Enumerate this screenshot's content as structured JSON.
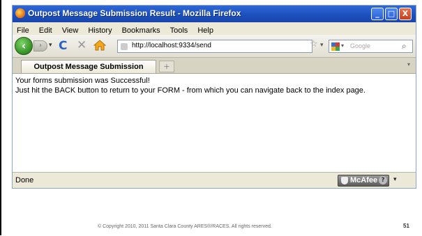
{
  "window": {
    "title": "Outpost Message Submission Result - Mozilla Firefox",
    "controls": {
      "minimize": "_",
      "maximize": "□",
      "close": "X"
    }
  },
  "menu": [
    "File",
    "Edit",
    "View",
    "History",
    "Bookmarks",
    "Tools",
    "Help"
  ],
  "toolbar": {
    "back": "‹",
    "forward": "›",
    "dropdown": "▾",
    "reload": "C",
    "stop": "✕",
    "url": "http://localhost:9334/send",
    "bookmark_star": "☆",
    "search_placeholder": "Google",
    "search_go": "⌕"
  },
  "tabs": {
    "active": "Outpost Message Submission Result",
    "new_tab": "+",
    "list": "▾"
  },
  "content": {
    "line1": "Your forms submission was Successful!",
    "line2": "Just hit the BACK button to return to your FORM - from which you can navigate back to the index page."
  },
  "status": {
    "text": "Done",
    "mcafee": "McAfee",
    "mcafee_help": "?",
    "mcafee_drop": "▾"
  },
  "footer": {
    "copyright": "© Copyright 2010, 2011 Santa Clara County ARES®/RACES. All rights reserved.",
    "page_number": "51"
  },
  "colors": {
    "titlebar": "#1b4fba",
    "chrome": "#ece9d8",
    "back_button": "#2c8a1c"
  }
}
